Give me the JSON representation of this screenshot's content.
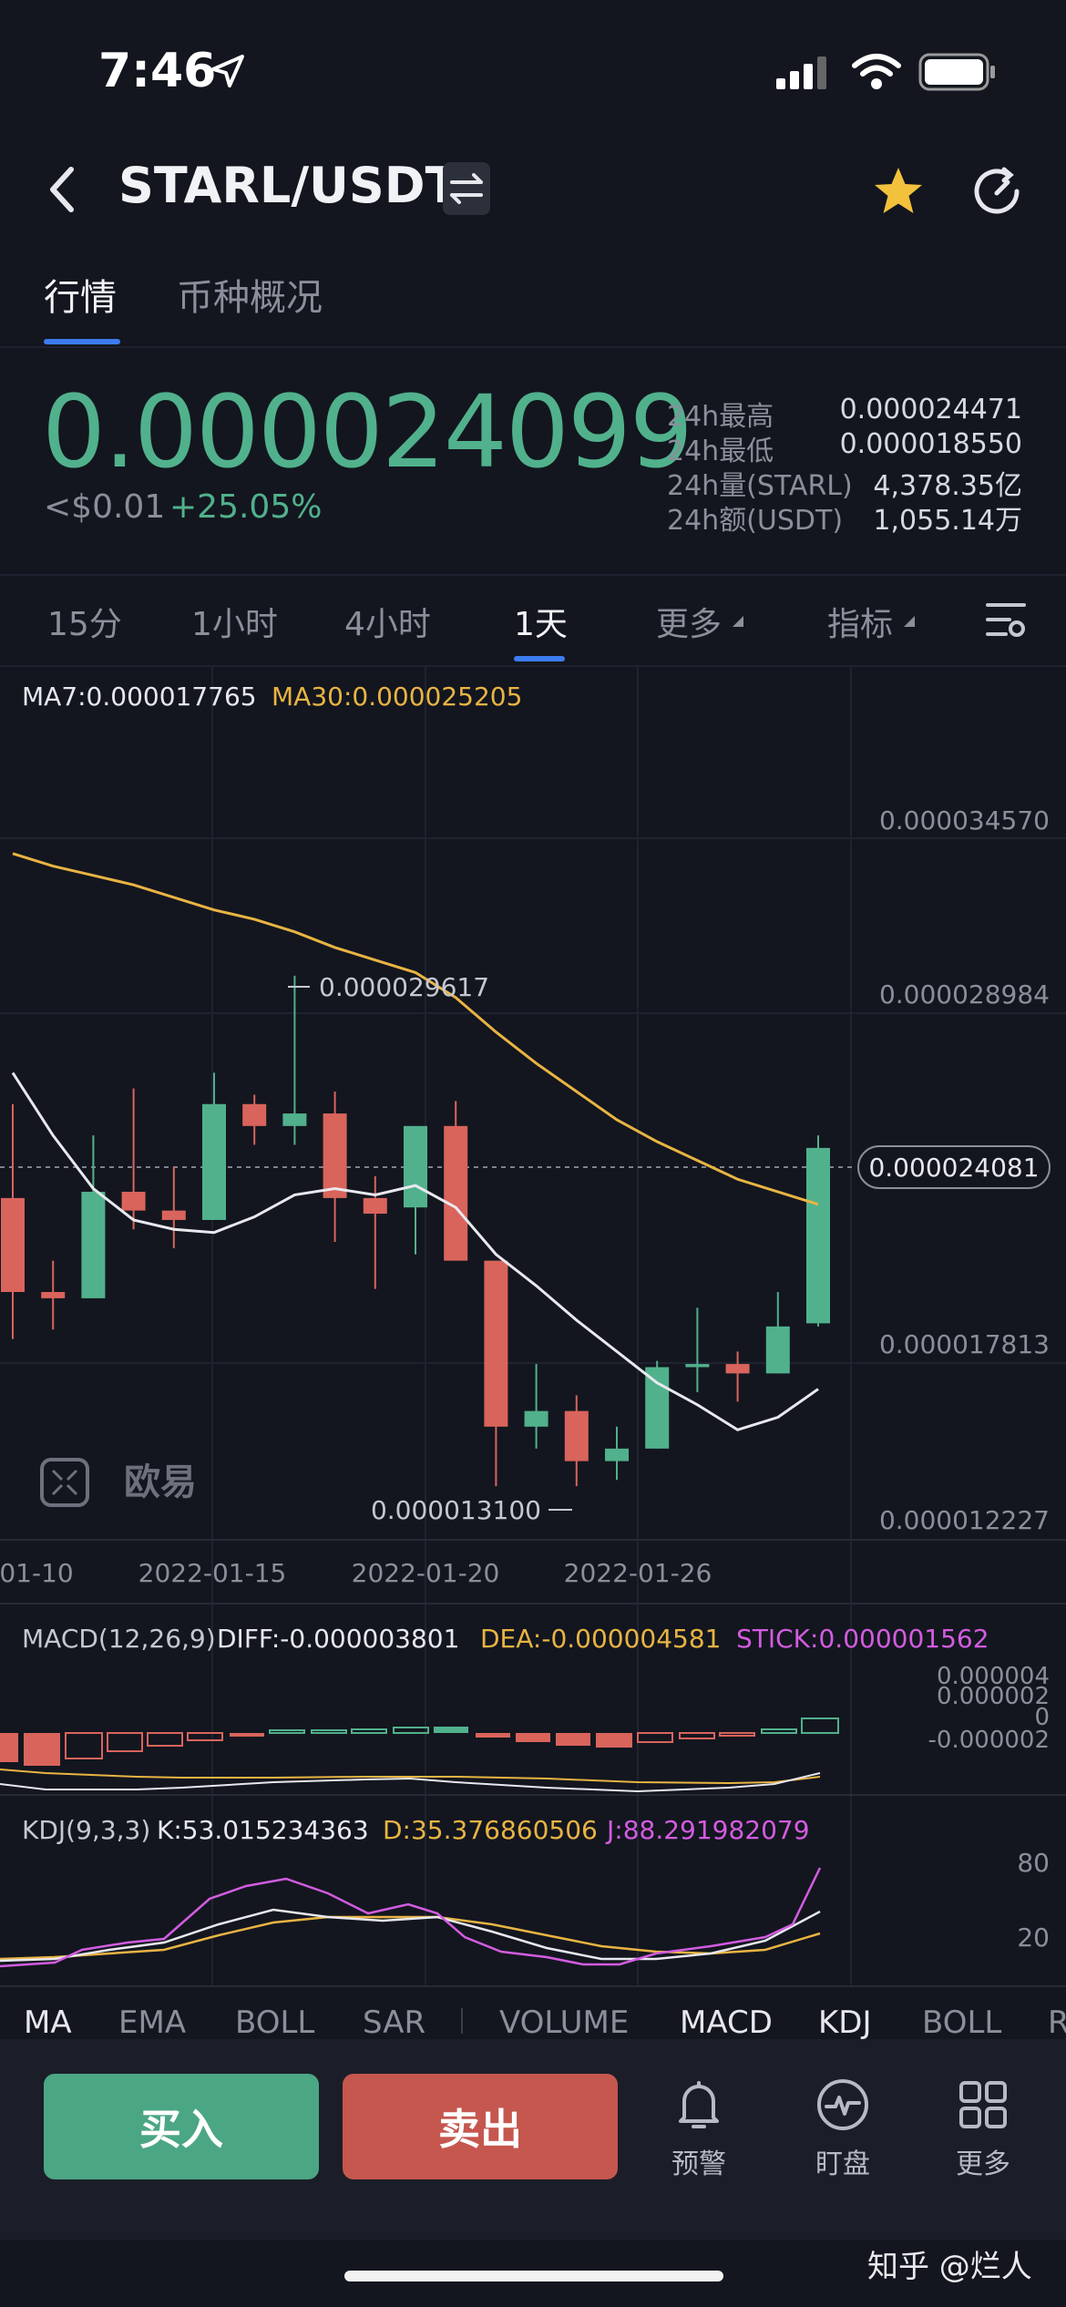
{
  "status_bar": {
    "time": "7:46"
  },
  "header": {
    "pair": "STARL/USDT"
  },
  "tabs": [
    {
      "label": "行情"
    },
    {
      "label": "币种概况"
    }
  ],
  "price": {
    "last": "0.000024099",
    "usd": "<$0.01",
    "change": "+25.05%",
    "stats": [
      {
        "label": "24h最高",
        "value": "0.000024471"
      },
      {
        "label": "24h最低",
        "value": "0.000018550"
      },
      {
        "label": "24h量(STARL)",
        "value": "4,378.35亿"
      },
      {
        "label": "24h额(USDT)",
        "value": "1,055.14万"
      }
    ]
  },
  "timeframes": [
    {
      "label": "15分"
    },
    {
      "label": "1小时"
    },
    {
      "label": "4小时"
    },
    {
      "label": "1天",
      "active": true
    },
    {
      "label": "更多"
    },
    {
      "label": "指标"
    }
  ],
  "chart": {
    "ma7_label": "MA7:0.000017765",
    "ma30_label": "MA30:0.000025205",
    "y_ticks": [
      "0.000034570",
      "0.000028984",
      "0.000017813",
      "0.000012227"
    ],
    "current_price_tag": "0.000024081",
    "high_marker": "0.000029617",
    "low_marker": "0.000013100",
    "x_ticks": [
      "01-10",
      "2022-01-15",
      "2022-01-20",
      "2022-01-26"
    ],
    "logo_text": "欧易",
    "macd_label": "MACD(12,26,9)",
    "diff_label": "DIFF:-0.000003801",
    "dea_label": "DEA:-0.000004581",
    "stick_label": "STICK:0.000001562",
    "macd_ticks": [
      "0.000004",
      "0.000002",
      "0",
      "-0.000002"
    ],
    "kdj_label": "KDJ(9,3,3)",
    "k_label": "K:53.015234363",
    "d_label": "D:35.376860506",
    "j_label": "J:88.291982079",
    "kdj_ticks": [
      "80",
      "20"
    ]
  },
  "indicator_tabs": [
    "MA",
    "EMA",
    "BOLL",
    "SAR",
    "VOLUME",
    "MACD",
    "KDJ",
    "BOLL",
    "R"
  ],
  "actions": {
    "buy": "买入",
    "sell": "卖出",
    "alert": "预警",
    "watch": "盯盘",
    "more": "更多"
  },
  "watermark": "知乎 @烂人",
  "colors": {
    "up": "#51b18c",
    "down": "#d9645c",
    "ma30": "#e9b443",
    "macd_stick": "#d35ce0",
    "accent": "#3d7cf0"
  },
  "chart_data": {
    "type": "candlestick",
    "x_ticks": [
      "01-10",
      "2022-01-15",
      "2022-01-20",
      "2022-01-26"
    ],
    "ylim": [
      1.2227e-05,
      3.457e-05
    ],
    "candles": [
      {
        "open": 2.25e-05,
        "close": 1.95e-05,
        "high": 2.55e-05,
        "low": 1.8e-05
      },
      {
        "open": 1.95e-05,
        "close": 1.93e-05,
        "high": 2.05e-05,
        "low": 1.83e-05
      },
      {
        "open": 1.93e-05,
        "close": 2.27e-05,
        "high": 2.45e-05,
        "low": 1.93e-05
      },
      {
        "open": 2.27e-05,
        "close": 2.21e-05,
        "high": 2.6e-05,
        "low": 2.15e-05
      },
      {
        "open": 2.21e-05,
        "close": 2.18e-05,
        "high": 2.35e-05,
        "low": 2.09e-05
      },
      {
        "open": 2.18e-05,
        "close": 2.55e-05,
        "high": 2.65e-05,
        "low": 2.18e-05
      },
      {
        "open": 2.55e-05,
        "close": 2.48e-05,
        "high": 2.58e-05,
        "low": 2.42e-05
      },
      {
        "open": 2.48e-05,
        "close": 2.52e-05,
        "high": 2.96e-05,
        "low": 2.42e-05
      },
      {
        "open": 2.52e-05,
        "close": 2.25e-05,
        "high": 2.59e-05,
        "low": 2.11e-05
      },
      {
        "open": 2.25e-05,
        "close": 2.2e-05,
        "high": 2.32e-05,
        "low": 1.96e-05
      },
      {
        "open": 2.22e-05,
        "close": 2.48e-05,
        "high": 2.48e-05,
        "low": 2.07e-05
      },
      {
        "open": 2.48e-05,
        "close": 2.05e-05,
        "high": 2.56e-05,
        "low": 2.05e-05
      },
      {
        "open": 2.05e-05,
        "close": 1.52e-05,
        "high": 2.05e-05,
        "low": 1.33e-05
      },
      {
        "open": 1.52e-05,
        "close": 1.57e-05,
        "high": 1.72e-05,
        "low": 1.45e-05
      },
      {
        "open": 1.57e-05,
        "close": 1.41e-05,
        "high": 1.62e-05,
        "low": 1.33e-05
      },
      {
        "open": 1.41e-05,
        "close": 1.45e-05,
        "high": 1.52e-05,
        "low": 1.35e-05
      },
      {
        "open": 1.45e-05,
        "close": 1.71e-05,
        "high": 1.73e-05,
        "low": 1.45e-05
      },
      {
        "open": 1.71e-05,
        "close": 1.72e-05,
        "high": 1.9e-05,
        "low": 1.63e-05
      },
      {
        "open": 1.72e-05,
        "close": 1.69e-05,
        "high": 1.76e-05,
        "low": 1.6e-05
      },
      {
        "open": 1.69e-05,
        "close": 1.84e-05,
        "high": 1.95e-05,
        "low": 1.69e-05
      },
      {
        "open": 1.85e-05,
        "close": 2.41e-05,
        "high": 2.45e-05,
        "low": 1.84e-05
      }
    ],
    "ma7": [
      2.65e-05,
      2.45e-05,
      2.28e-05,
      2.18e-05,
      2.15e-05,
      2.14e-05,
      2.19e-05,
      2.26e-05,
      2.28e-05,
      2.26e-05,
      2.29e-05,
      2.22e-05,
      2.07e-05,
      1.97e-05,
      1.86e-05,
      1.76e-05,
      1.66e-05,
      1.59e-05,
      1.51e-05,
      1.55e-05,
      1.64e-05
    ],
    "ma30": [
      3.35e-05,
      3.31e-05,
      3.28e-05,
      3.25e-05,
      3.21e-05,
      3.17e-05,
      3.14e-05,
      3.1e-05,
      3.05e-05,
      3.01e-05,
      2.97e-05,
      2.89e-05,
      2.78e-05,
      2.68e-05,
      2.59e-05,
      2.5e-05,
      2.43e-05,
      2.37e-05,
      2.31e-05,
      2.27e-05,
      2.23e-05
    ]
  }
}
